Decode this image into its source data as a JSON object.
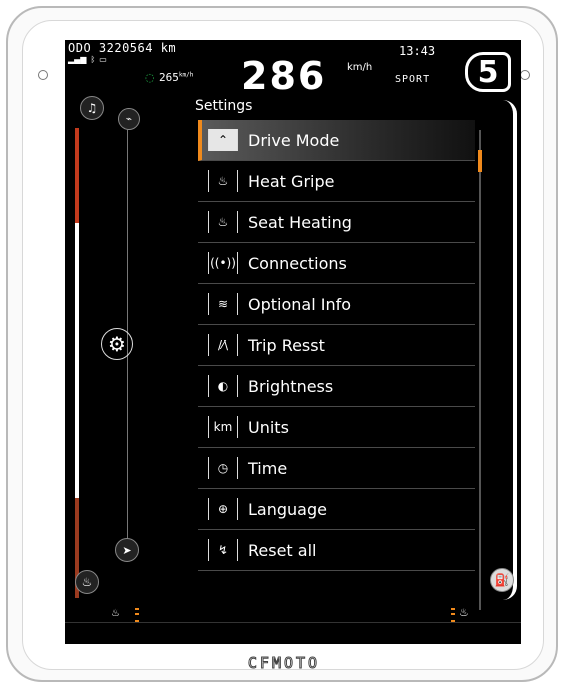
{
  "cluster": {
    "odometer": "ODO 3220564 km",
    "clock": "13:43",
    "range": "265",
    "range_unit": "km/h",
    "speed": "286",
    "speed_unit": "km/h",
    "ride_mode": "SPORT",
    "gear": "5"
  },
  "settings": {
    "title": "Settings",
    "selected_index": 0,
    "items": [
      {
        "label": "Drive  Mode",
        "icon": "drive-mode-icon",
        "glyph": "⌃"
      },
      {
        "label": "Heat Gripe",
        "icon": "heated-grip-icon",
        "glyph": "♨"
      },
      {
        "label": "Seat Heating",
        "icon": "seat-heating-icon",
        "glyph": "♨"
      },
      {
        "label": "Connections",
        "icon": "connections-icon",
        "glyph": "((•))"
      },
      {
        "label": "Optional Info",
        "icon": "layers-icon",
        "glyph": "≋"
      },
      {
        "label": "Trip Resst",
        "icon": "trip-icon",
        "glyph": "/⁄\\"
      },
      {
        "label": "Brightness",
        "icon": "brightness-icon",
        "glyph": "◐"
      },
      {
        "label": "Units",
        "icon": "units-icon",
        "glyph": "km"
      },
      {
        "label": "Time",
        "icon": "clock-icon",
        "glyph": "◷"
      },
      {
        "label": "Language",
        "icon": "globe-icon",
        "glyph": "⊕"
      },
      {
        "label": "Reset all",
        "icon": "reset-icon",
        "glyph": "↯"
      }
    ]
  },
  "brand": "CFMOTO",
  "colors": {
    "accent": "#f08a1c",
    "limit_icon": "#21b24a",
    "gauge_red": "#c23a1d"
  }
}
